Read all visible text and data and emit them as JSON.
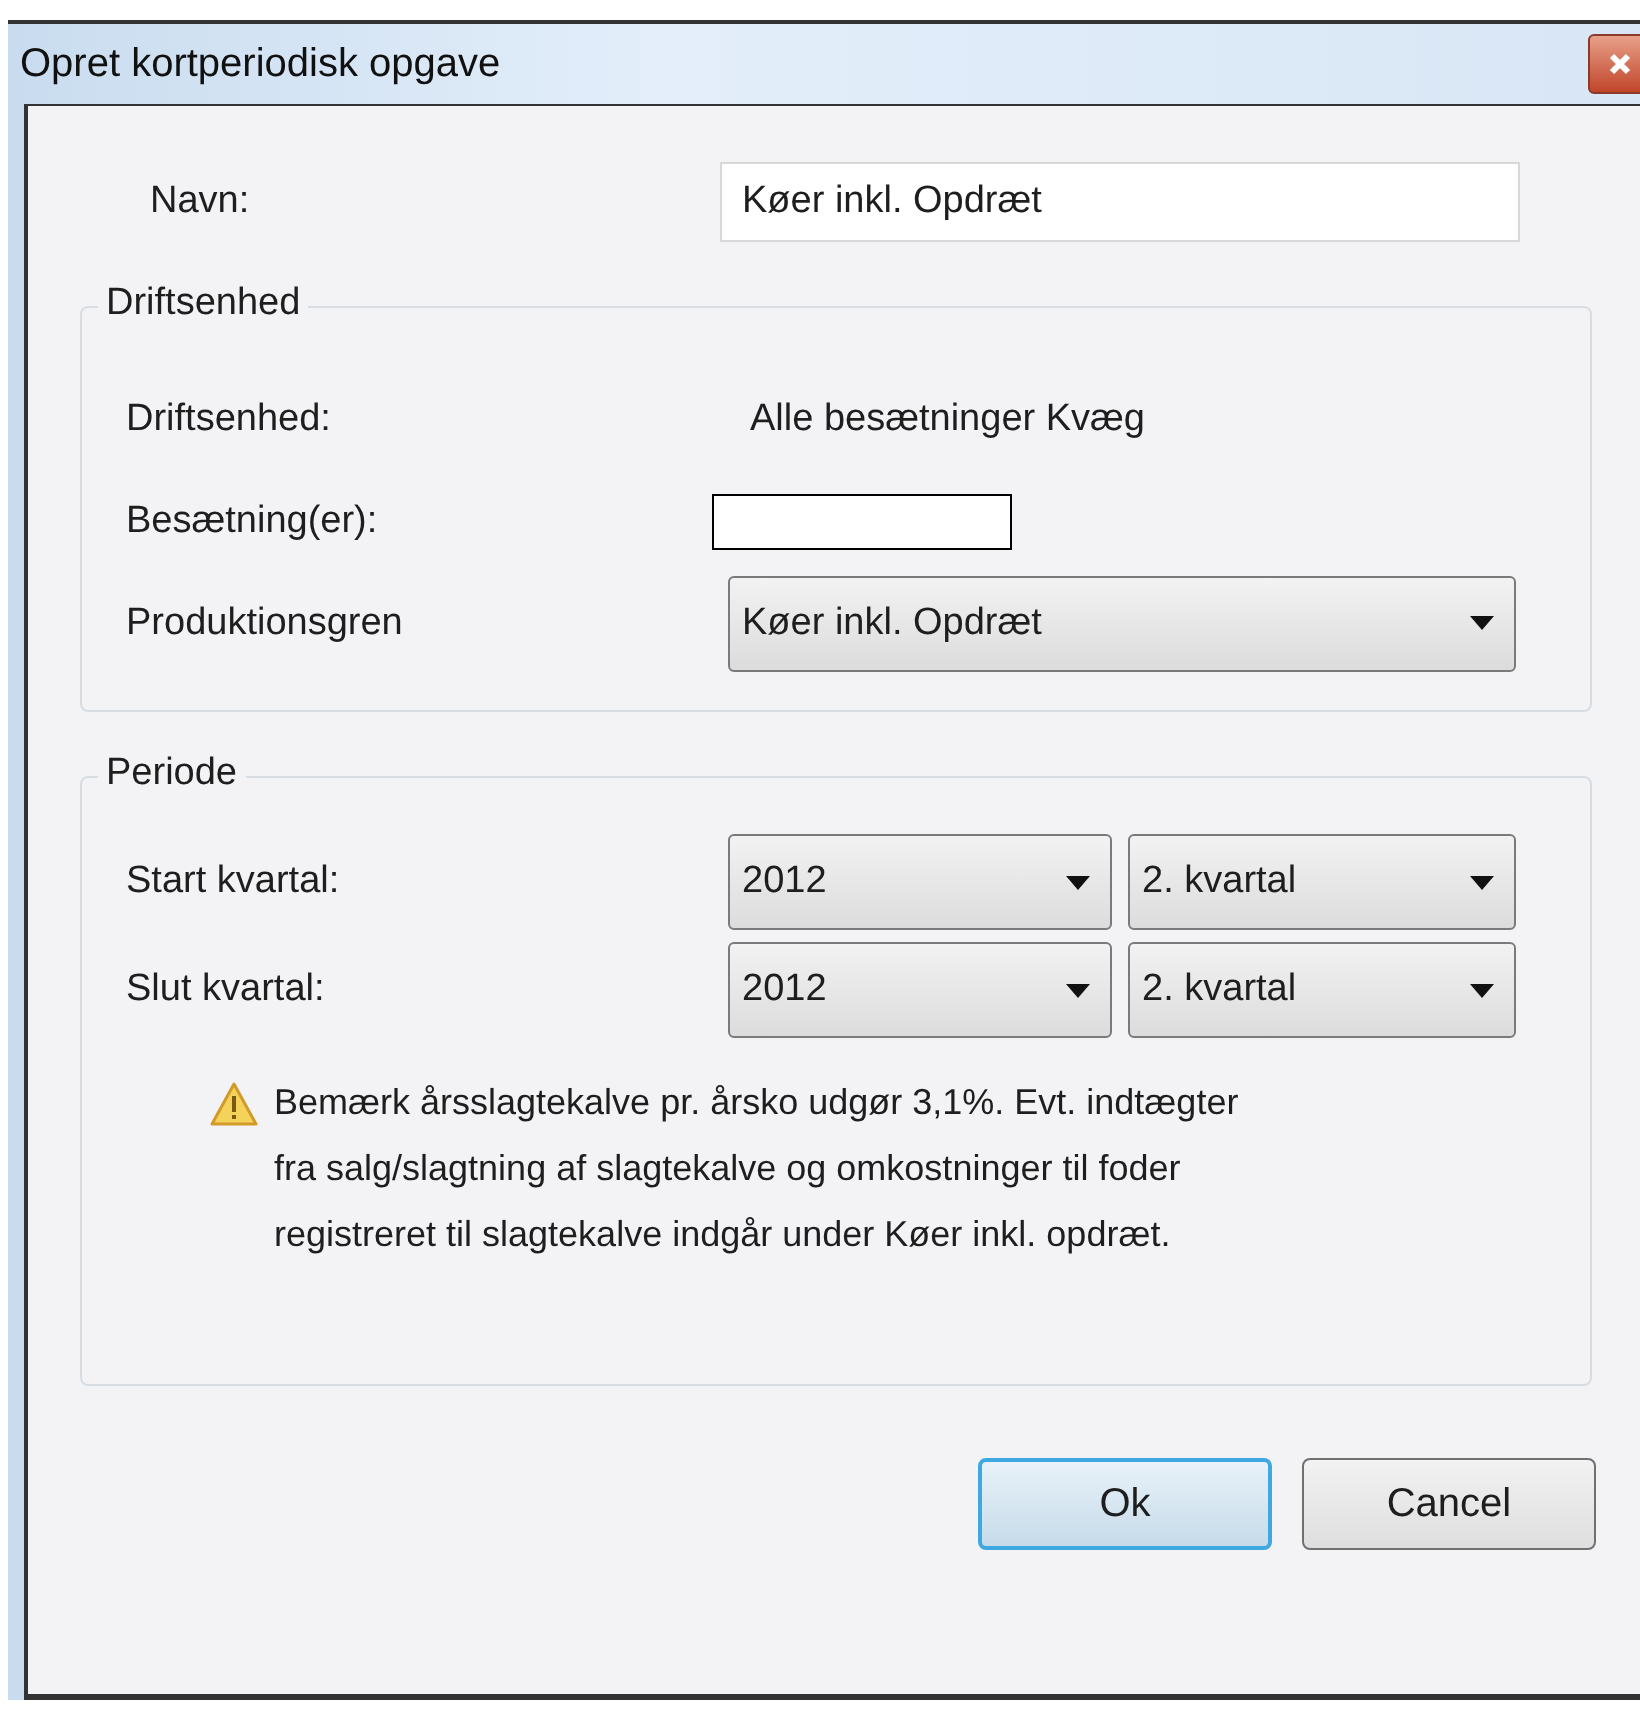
{
  "window": {
    "title": "Opret kortperiodisk opgave"
  },
  "name_field": {
    "label": "Navn:",
    "value": "Køer inkl. Opdræt"
  },
  "driftsenhed": {
    "legend": "Driftsenhed",
    "rows": [
      {
        "kind": "text",
        "label": "Driftsenhed:",
        "value": "Alle besætninger Kvæg"
      },
      {
        "kind": "redacted",
        "label": "Besætning(er):"
      },
      {
        "kind": "combo",
        "label": "Produktionsgren",
        "value": "Køer inkl. Opdræt"
      }
    ]
  },
  "periode": {
    "legend": "Periode",
    "rows": [
      {
        "label": "Start kvartal:",
        "year": "2012",
        "quarter": "2. kvartal"
      },
      {
        "label": "Slut kvartal:",
        "year": "2012",
        "quarter": "2. kvartal"
      }
    ],
    "warning": "Bemærk årsslagtekalve pr. årsko udgør 3,1%. Evt. indtægter fra salg/slagtning af slagtekalve og omkostninger til foder registreret til slagtekalve indgår under Køer inkl. opdræt."
  },
  "buttons": [
    {
      "label": "Ok",
      "default": true
    },
    {
      "label": "Cancel",
      "default": false
    }
  ]
}
